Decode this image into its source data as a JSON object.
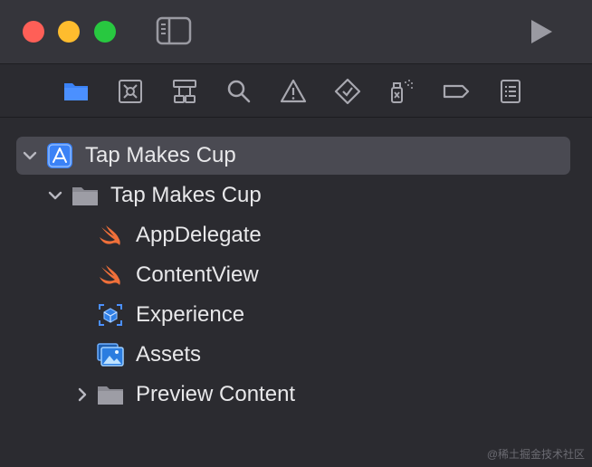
{
  "window": {
    "traffic_lights": [
      "close",
      "minimize",
      "zoom"
    ],
    "sidebar_toggle_icon": "sidebar-icon",
    "run_icon": "play-icon"
  },
  "navigator_tabs": [
    {
      "icon": "folder-icon",
      "active": true
    },
    {
      "icon": "source-control-icon",
      "active": false
    },
    {
      "icon": "hierarchy-icon",
      "active": false
    },
    {
      "icon": "search-icon",
      "active": false
    },
    {
      "icon": "warning-icon",
      "active": false
    },
    {
      "icon": "test-diamond-icon",
      "active": false
    },
    {
      "icon": "debug-spray-icon",
      "active": false
    },
    {
      "icon": "breakpoint-icon",
      "active": false
    },
    {
      "icon": "report-list-icon",
      "active": false
    }
  ],
  "tree": {
    "project": {
      "label": "Tap Makes Cup",
      "icon": "xcode-project-icon",
      "expanded": true
    },
    "group": {
      "label": "Tap Makes Cup",
      "icon": "folder-icon",
      "expanded": true
    },
    "files": [
      {
        "label": "AppDelegate",
        "icon": "swift-icon"
      },
      {
        "label": "ContentView",
        "icon": "swift-icon"
      },
      {
        "label": "Experience",
        "icon": "reality-composer-icon"
      },
      {
        "label": "Assets",
        "icon": "asset-catalog-icon"
      }
    ],
    "collapsed_group": {
      "label": "Preview Content",
      "icon": "folder-icon",
      "expanded": false
    }
  },
  "watermark": "@稀土掘金技术社区",
  "colors": {
    "accent": "#3b82f6",
    "swift": "#f0703a",
    "titlebar": "#35353b",
    "background": "#2b2b30",
    "selection": "#4a4a52"
  }
}
